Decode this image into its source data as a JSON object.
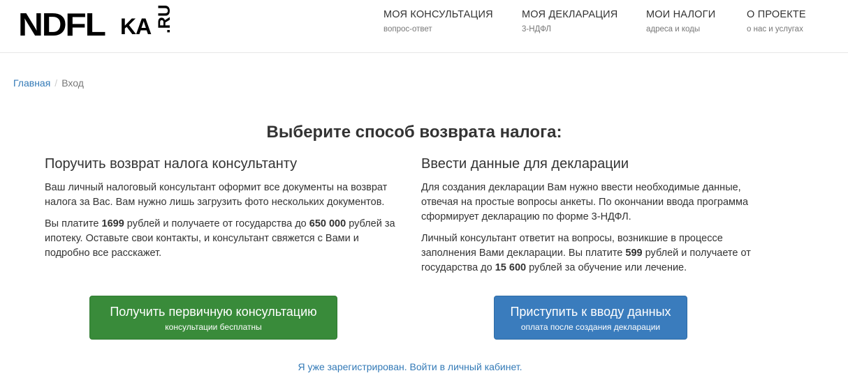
{
  "logo": {
    "main": "NDFL",
    "sub": "KA",
    "tld": ".RU"
  },
  "nav": [
    {
      "title": "Моя консультация",
      "sub": "вопрос-ответ"
    },
    {
      "title": "Моя декларация",
      "sub": "3-НДФЛ"
    },
    {
      "title": "Мои налоги",
      "sub": "адреса и коды"
    },
    {
      "title": "О проекте",
      "sub": "о нас и услугах"
    }
  ],
  "breadcrumb": {
    "home": "Главная",
    "separator": "/",
    "current": "Вход"
  },
  "page_title": "Выберите способ возврата налога:",
  "left": {
    "heading": "Поручить возврат налога консультанту",
    "p1": "Ваш личный налоговый консультант оформит все документы на возврат налога за Вас. Вам нужно лишь загрузить фото нескольких документов.",
    "p2_a": "Вы платите ",
    "p2_price": "1699",
    "p2_b": " рублей и получаете от государства до ",
    "p2_amount": "650 000",
    "p2_c": " рублей за ипотеку. Оставьте свои контакты, и консультант свяжется с Вами и подробно все расскажет.",
    "button_main": "Получить первичную консультацию",
    "button_sub": "консультации бесплатны"
  },
  "right": {
    "heading": "Ввести данные для декларации",
    "p1": "Для создания декларации Вам нужно ввести необходимые данные, отвечая на простые вопросы анкеты. По окончании ввода программа сформирует декларацию по форме 3-НДФЛ.",
    "p2_a": "Личный консультант ответит на вопросы, возникшие в процессе заполнения Вами декларации. Вы платите ",
    "p2_price": "599",
    "p2_b": " рублей и получаете от государства до ",
    "p2_amount": "15 600",
    "p2_c": " рублей за обучение или лечение.",
    "button_main": "Приступить к вводу данных",
    "button_sub": "оплата после создания декларации"
  },
  "login_link": "Я уже зарегистрирован. Войти в личный кабинет.",
  "colors": {
    "link": "#337ab7",
    "green_button": "#398b3a",
    "blue_button": "#3a7cbd"
  }
}
